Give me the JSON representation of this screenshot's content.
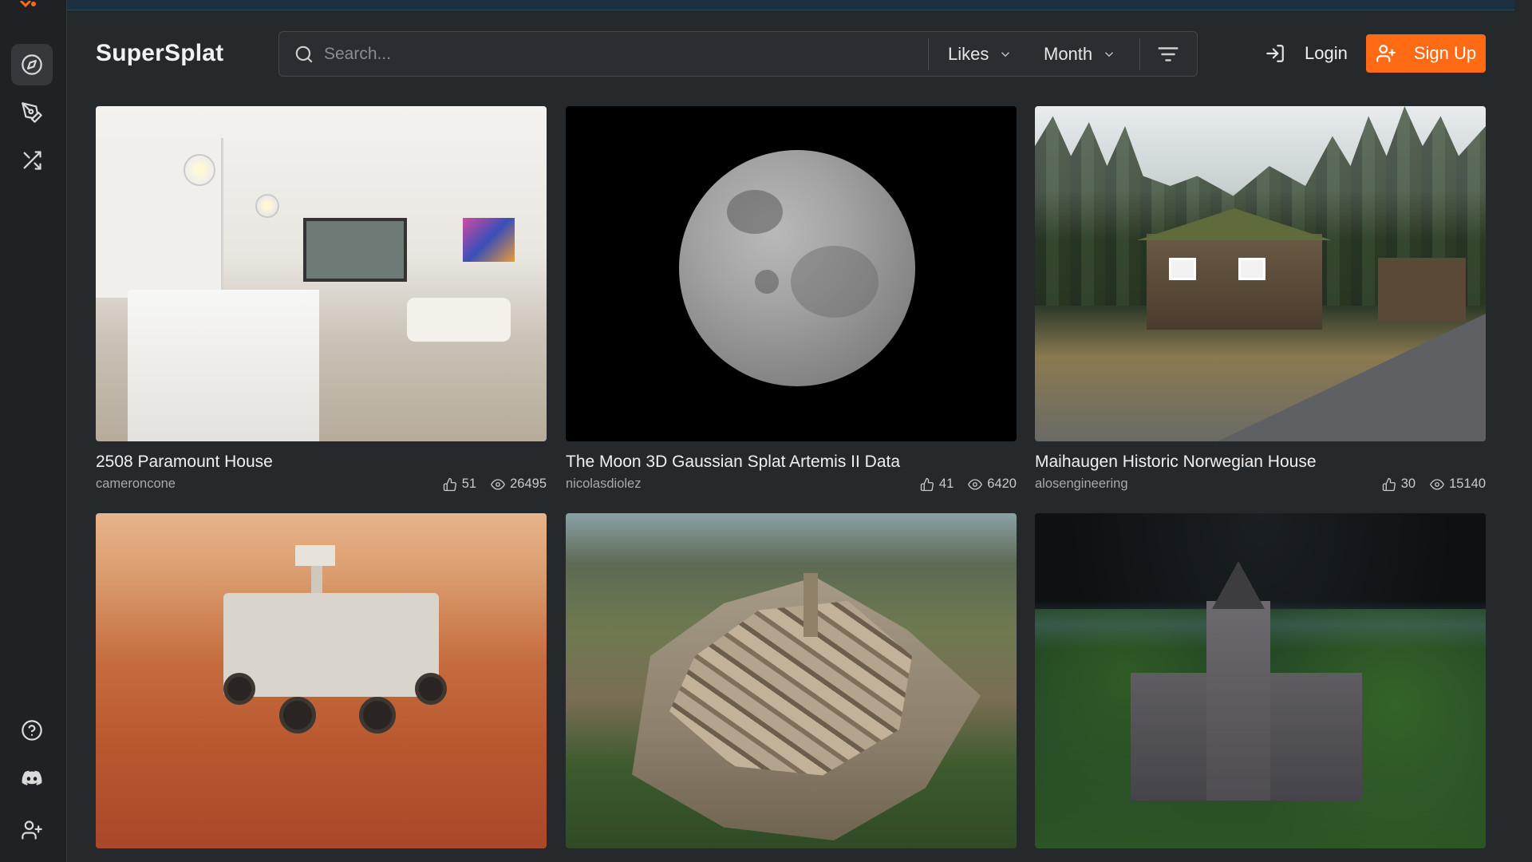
{
  "app": {
    "brand": "SuperSplat"
  },
  "sidebar": {
    "items": [
      {
        "name": "explore",
        "icon": "compass-icon",
        "active": true
      },
      {
        "name": "editor",
        "icon": "pen-tool-icon",
        "active": false
      },
      {
        "name": "random",
        "icon": "shuffle-icon",
        "active": false
      }
    ],
    "bottom": [
      {
        "name": "help",
        "icon": "help-circle-icon"
      },
      {
        "name": "discord",
        "icon": "discord-icon"
      },
      {
        "name": "invite",
        "icon": "user-plus-icon"
      }
    ]
  },
  "search": {
    "placeholder": "Search...",
    "value": ""
  },
  "filters": {
    "sort": "Likes",
    "period": "Month"
  },
  "auth": {
    "login_label": "Login",
    "signup_label": "Sign Up"
  },
  "colors": {
    "accent": "#ff6a14",
    "background": "#26292c",
    "rail": "#1f2124"
  },
  "cards": [
    {
      "title": "2508 Paramount House",
      "author": "cameroncone",
      "likes": "51",
      "views": "26495"
    },
    {
      "title": "The Moon 3D Gaussian Splat Artemis II Data",
      "author": "nicolasdiolez",
      "likes": "41",
      "views": "6420"
    },
    {
      "title": "Maihaugen Historic Norwegian House",
      "author": "alosengineering",
      "likes": "30",
      "views": "15140"
    },
    {
      "title": "",
      "author": "",
      "likes": "",
      "views": ""
    },
    {
      "title": "",
      "author": "",
      "likes": "",
      "views": ""
    },
    {
      "title": "",
      "author": "",
      "likes": "",
      "views": ""
    }
  ]
}
